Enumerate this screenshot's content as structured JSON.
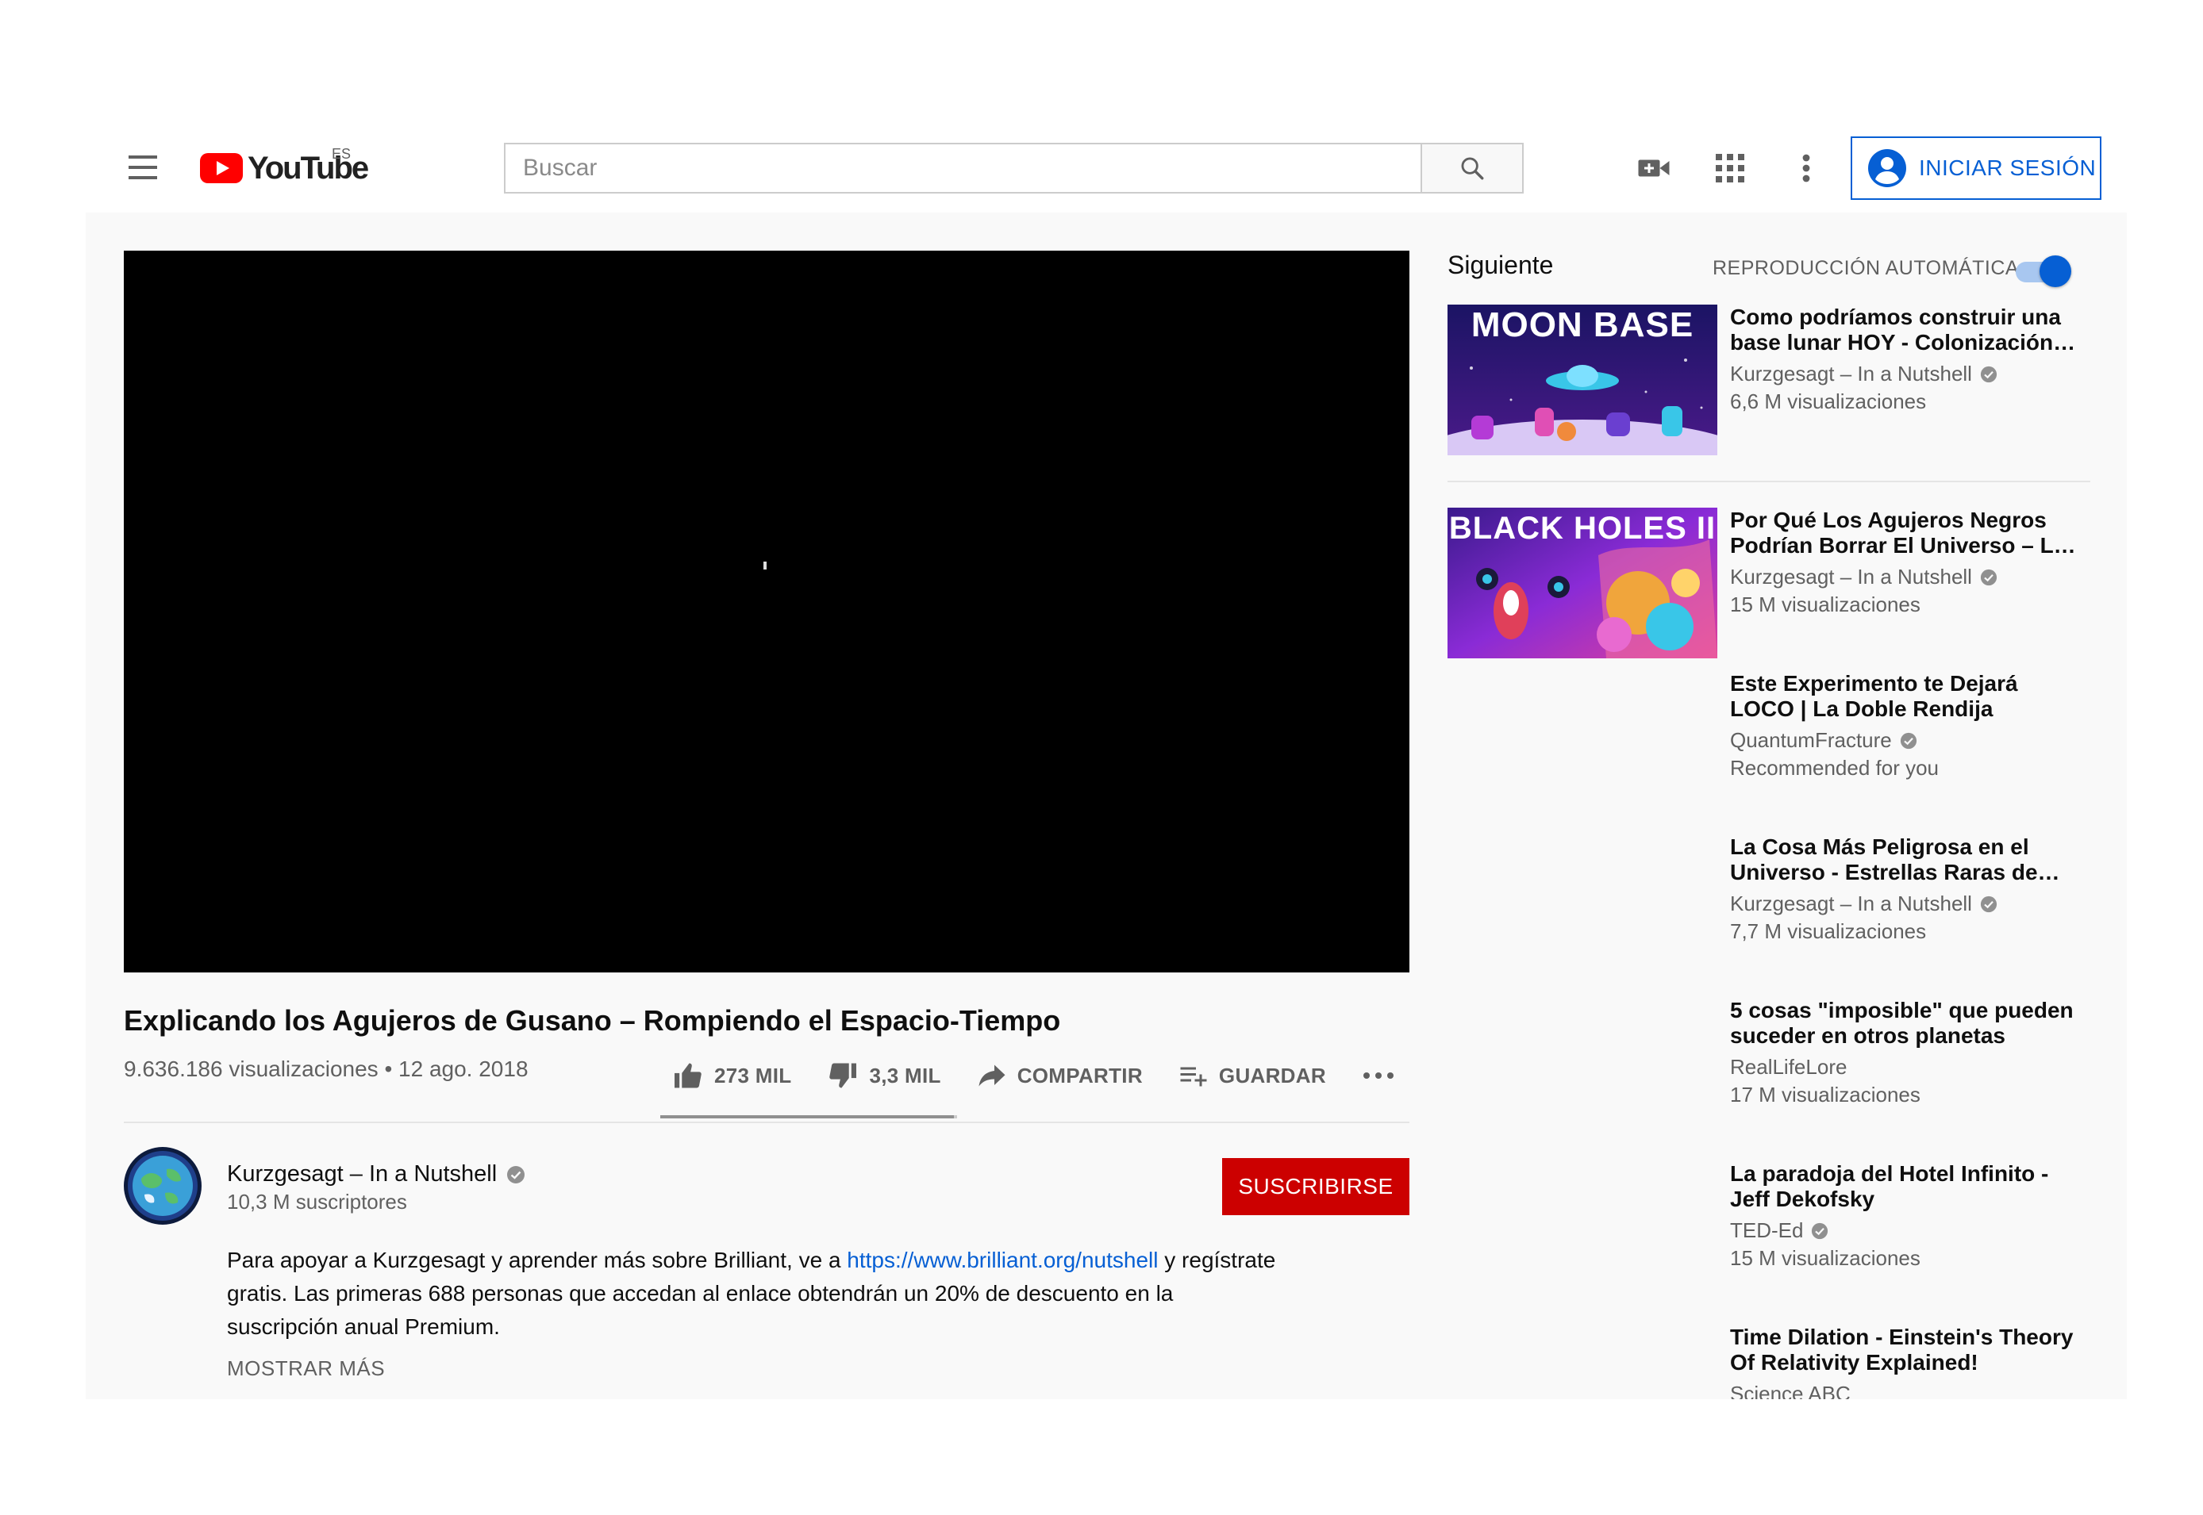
{
  "header": {
    "logo_text": "YouTube",
    "region": "ES",
    "search_placeholder": "Buscar",
    "signin_label": "INICIAR SESIÓN"
  },
  "video": {
    "title": "Explicando los Agujeros de Gusano – Rompiendo el Espacio-Tiempo",
    "meta": "9.636.186 visualizaciones • 12 ago. 2018",
    "like_count": "273 MIL",
    "dislike_count": "3,3 MIL",
    "share_label": "COMPARTIR",
    "save_label": "GUARDAR",
    "like_ratio": 0.988
  },
  "channel": {
    "name": "Kurzgesagt – In a Nutshell",
    "subscribers": "10,3 M suscriptores",
    "subscribe_label": "SUSCRIBIRSE"
  },
  "description": {
    "text_before": "Para apoyar a Kurzgesagt y aprender más sobre Brilliant, ve a ",
    "link": "https://www.brilliant.org/nutshell",
    "text_after": " y regístrate gratis. Las primeras 688 personas que accedan al enlace obtendrán un 20% de descuento en la suscripción anual Premium.",
    "show_more": "MOSTRAR MÁS"
  },
  "sidebar": {
    "up_next": "Siguiente",
    "autoplay_label": "REPRODUCCIÓN AUTOMÁTICA",
    "autoplay_on": true,
    "items": [
      {
        "title": "Como podríamos construir una base lunar HOY - Colonización del Espacio",
        "channel": "Kurzgesagt – In a Nutshell",
        "verified": true,
        "views": "6,6 M visualizaciones",
        "thumb_text": "MOON BASE"
      },
      {
        "title": "Por Qué Los Agujeros Negros Podrían Borrar El Universo – La Paradoja de la Información",
        "channel": "Kurzgesagt – In a Nutshell",
        "verified": true,
        "views": "15 M visualizaciones",
        "thumb_text": "BLACK HOLES II"
      },
      {
        "title": "Este Experimento te Dejará LOCO | La Doble Rendija",
        "channel": "QuantumFracture",
        "verified": true,
        "views": "Recommended for you"
      },
      {
        "title": "La Cosa Más Peligrosa en el Universo - Estrellas Raras de Quarks",
        "channel": "Kurzgesagt – In a Nutshell",
        "verified": true,
        "views": "7,7 M visualizaciones"
      },
      {
        "title": "5 cosas \"imposible\" que pueden suceder en otros planetas",
        "channel": "RealLifeLore",
        "verified": false,
        "views": "17 M visualizaciones"
      },
      {
        "title": "La paradoja del Hotel Infinito - Jeff Dekofsky",
        "channel": "TED-Ed",
        "verified": true,
        "views": "15 M visualizaciones"
      },
      {
        "title": "Time Dilation - Einstein's Theory Of Relativity Explained!",
        "channel": "Science ABC",
        "verified": false,
        "views": ""
      }
    ]
  },
  "colors": {
    "brand_red": "#ff0000",
    "subscribe_red": "#cc0000",
    "link_blue": "#065fd4",
    "secondary_text": "#606060"
  }
}
